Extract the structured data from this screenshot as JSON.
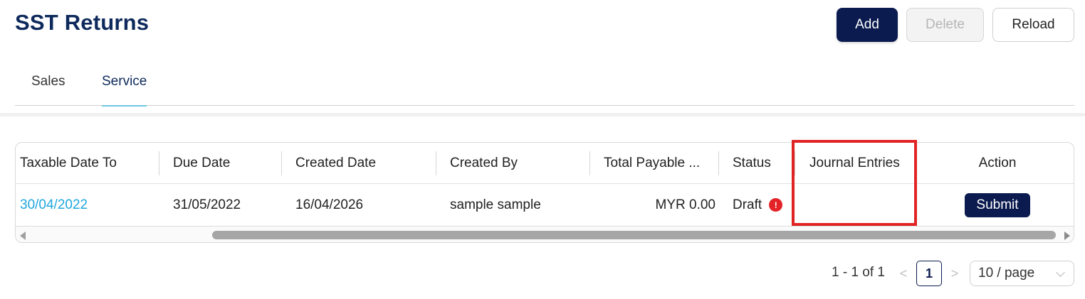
{
  "header": {
    "title": "SST Returns",
    "add_label": "Add",
    "delete_label": "Delete",
    "reload_label": "Reload"
  },
  "tabs": [
    {
      "label": "Sales",
      "active": false
    },
    {
      "label": "Service",
      "active": true
    }
  ],
  "table": {
    "columns": [
      "Taxable Date To",
      "Due Date",
      "Created Date",
      "Created By",
      "Total Payable ...",
      "Status",
      "Journal Entries",
      "Action"
    ],
    "rows": [
      {
        "taxable_date_to": "30/04/2022",
        "due_date": "31/05/2022",
        "created_date": "16/04/2026",
        "created_by": "sample sample",
        "total_payable": "MYR 0.00",
        "status": "Draft",
        "status_icon": "!",
        "journal_entries": "",
        "action_label": "Submit"
      }
    ]
  },
  "pagination": {
    "range_text": "1 - 1 of 1",
    "prev": "<",
    "current_page": "1",
    "next": ">",
    "page_size": "10 / page"
  },
  "colors": {
    "primary": "#0b1b4f",
    "title": "#0e2a5c",
    "link": "#1ea7dd",
    "tab_underline": "#6dc6e4",
    "error": "#e42328",
    "highlight": "#e02424"
  }
}
